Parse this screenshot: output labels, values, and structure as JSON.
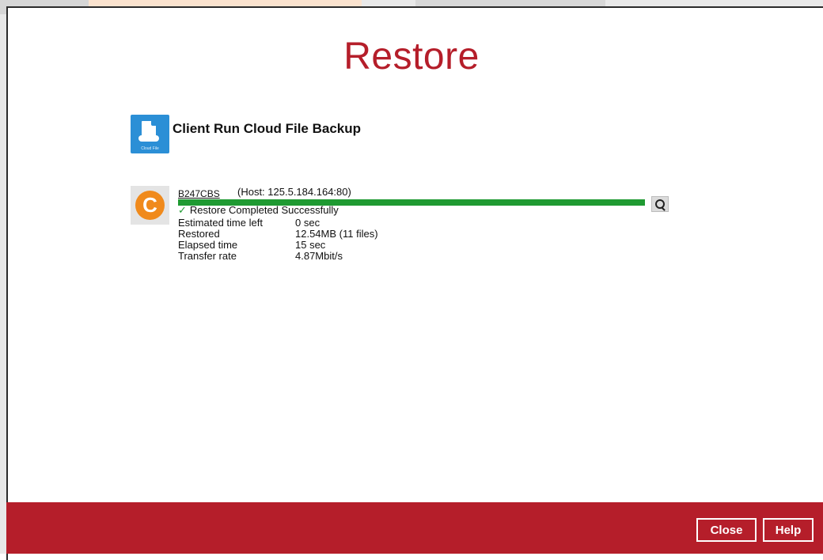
{
  "dialog": {
    "title": "Restore"
  },
  "backup_set": {
    "icon": "cloud-file-icon",
    "icon_caption": "Cloud File",
    "name": "Client Run Cloud File Backup"
  },
  "destination": {
    "icon": "cbs-logo-icon",
    "icon_letter": "C",
    "name": "B247CBS",
    "host": "(Host: 125.5.184.164:80)",
    "progress_percent": 100,
    "status_check": "✓",
    "status": "Restore Completed Successfully",
    "stats": [
      {
        "label": "Estimated time left",
        "value": "0 sec"
      },
      {
        "label": "Restored",
        "value": "12.54MB (11 files)"
      },
      {
        "label": "Elapsed time",
        "value": "15 sec"
      },
      {
        "label": "Transfer rate",
        "value": "4.87Mbit/s"
      }
    ],
    "detail_icon": "magnifier-icon"
  },
  "footer": {
    "close_label": "Close",
    "help_label": "Help"
  },
  "colors": {
    "brand_red": "#b51e2a",
    "progress_green": "#1f9a32",
    "cbs_orange": "#f08a1c",
    "cloud_blue": "#2b8fd6"
  }
}
